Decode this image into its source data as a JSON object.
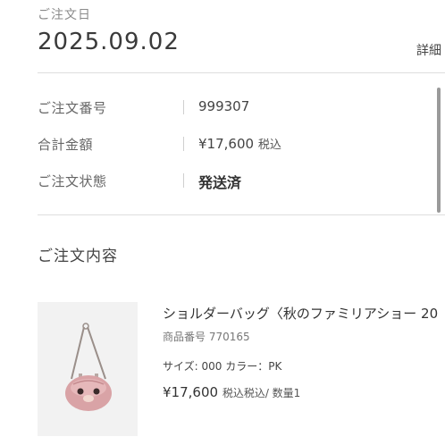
{
  "order": {
    "date_label": "ご注文日",
    "date_value": "2025.09.02",
    "details_link": "詳細"
  },
  "info": {
    "number_label": "ご注文番号",
    "number_value": "999307",
    "total_label": "合計金額",
    "total_value": "¥17,600",
    "total_tax": "税込",
    "status_label": "ご注文状態",
    "status_value": "発送済"
  },
  "contents": {
    "heading": "ご注文内容"
  },
  "product": {
    "name": "ショルダーバッグ〈秋のファミリアショー 20",
    "code": "商品番号 770165",
    "spec": "サイズ: 000 カラー：PK",
    "price": "¥17,600",
    "price_tax": "税込",
    "quantity": "税込/ 数量1",
    "image_icon": "pink-shoulder-bag-image"
  },
  "colors": {
    "bag_body": "#d9a3a6",
    "bag_strap": "#9a8f8a",
    "thumb_bg": "#f2f2f2"
  }
}
